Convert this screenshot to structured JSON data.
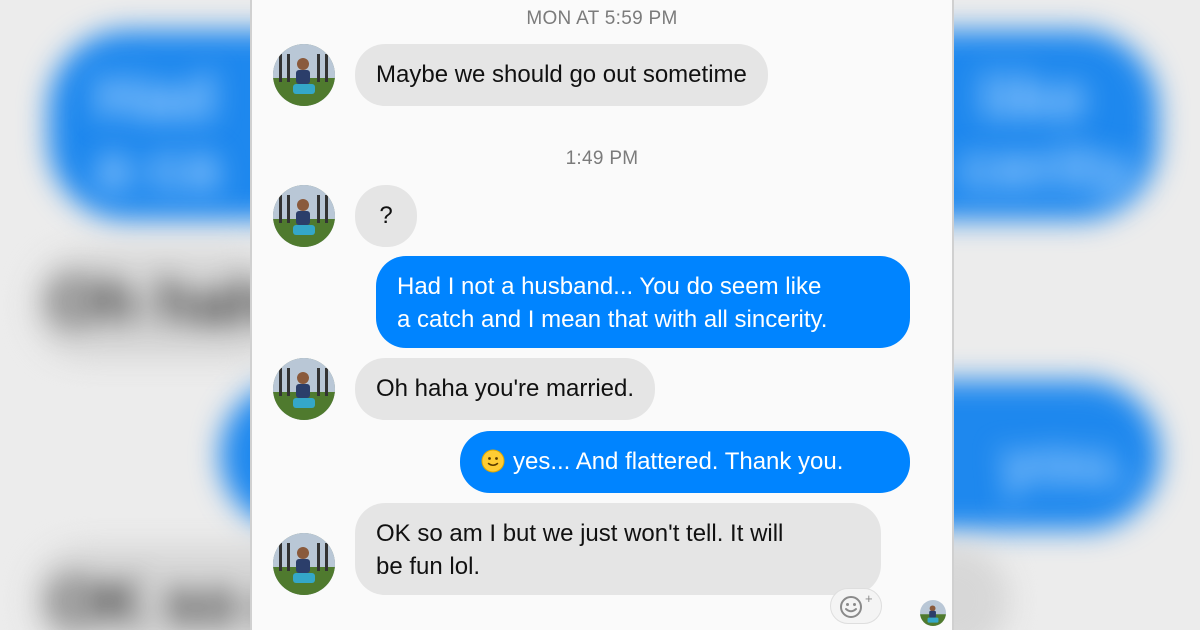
{
  "backdrop": {
    "left_texts": [
      "Had",
      "a ca",
      "Oh haha",
      "OK so a"
    ],
    "right_texts": [
      "like",
      "cerity.",
      "you."
    ]
  },
  "conversation": {
    "timestamps": [
      "MON AT 5:59 PM",
      "1:49 PM"
    ],
    "messages": [
      {
        "sender": "them",
        "lines": [
          "Maybe we should go out sometime"
        ]
      },
      {
        "sender": "them",
        "lines": [
          "?"
        ]
      },
      {
        "sender": "me",
        "lines": [
          "Had I not a husband... You do seem like",
          "a catch and I mean that with all sincerity."
        ]
      },
      {
        "sender": "them",
        "lines": [
          "Oh haha you're married."
        ]
      },
      {
        "sender": "me",
        "emoji": "slightly-smiling-face",
        "lines": [
          "yes... And flattered. Thank you."
        ]
      },
      {
        "sender": "them",
        "lines": [
          "OK so am I but we just won't tell. It will",
          "be fun lol."
        ]
      }
    ]
  },
  "reaction_button": {
    "icon": "add-reaction-icon",
    "symbol": "+"
  },
  "colors": {
    "outgoing_bubble": "#0084ff",
    "incoming_bubble": "#e5e5e5",
    "panel_background": "#fafafa",
    "timestamp_text": "#7b7b7b"
  }
}
